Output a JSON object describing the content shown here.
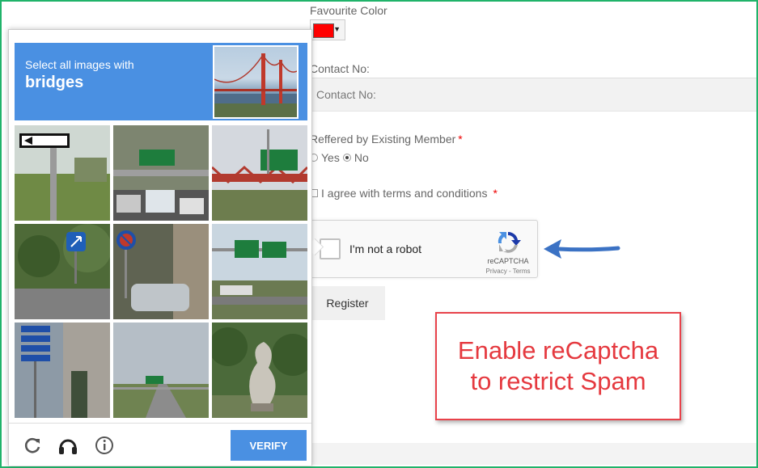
{
  "form": {
    "favourite_color_label": "Favourite Color",
    "favourite_color_value": "#ff0000",
    "contact_label": "Contact No:",
    "contact_placeholder": "Contact No:",
    "referred_label": "Reffered by Existing Member",
    "required_mark": "*",
    "radio_yes": "Yes",
    "radio_no": "No",
    "radio_selected": "No",
    "agree_label": "I agree with terms and conditions",
    "register_label": "Register"
  },
  "recaptcha_widget": {
    "label": "I'm not a robot",
    "brand": "reCAPTCHA",
    "terms": "Privacy - Terms"
  },
  "challenge": {
    "prompt": "Select all images with",
    "keyword": "bridges",
    "tiles": [
      {
        "content": "one-way street sign"
      },
      {
        "content": "highway traffic with green signs"
      },
      {
        "content": "red truss bridge under green sign"
      },
      {
        "content": "blue road sign among trees"
      },
      {
        "content": "no-parking sign with parked car"
      },
      {
        "content": "overhead highway sign gantry"
      },
      {
        "content": "street signs pole by building"
      },
      {
        "content": "road with distant green sign"
      },
      {
        "content": "stone sculpture in park"
      }
    ],
    "verify_label": "VERIFY",
    "icons": [
      "reload-icon",
      "headphones-icon",
      "info-icon"
    ]
  },
  "callout": {
    "line1": "Enable reCaptcha",
    "line2": "to restrict Spam"
  },
  "colors": {
    "frame": "#20b36a",
    "accent_blue": "#4a90e2",
    "callout_red": "#e5393f"
  }
}
